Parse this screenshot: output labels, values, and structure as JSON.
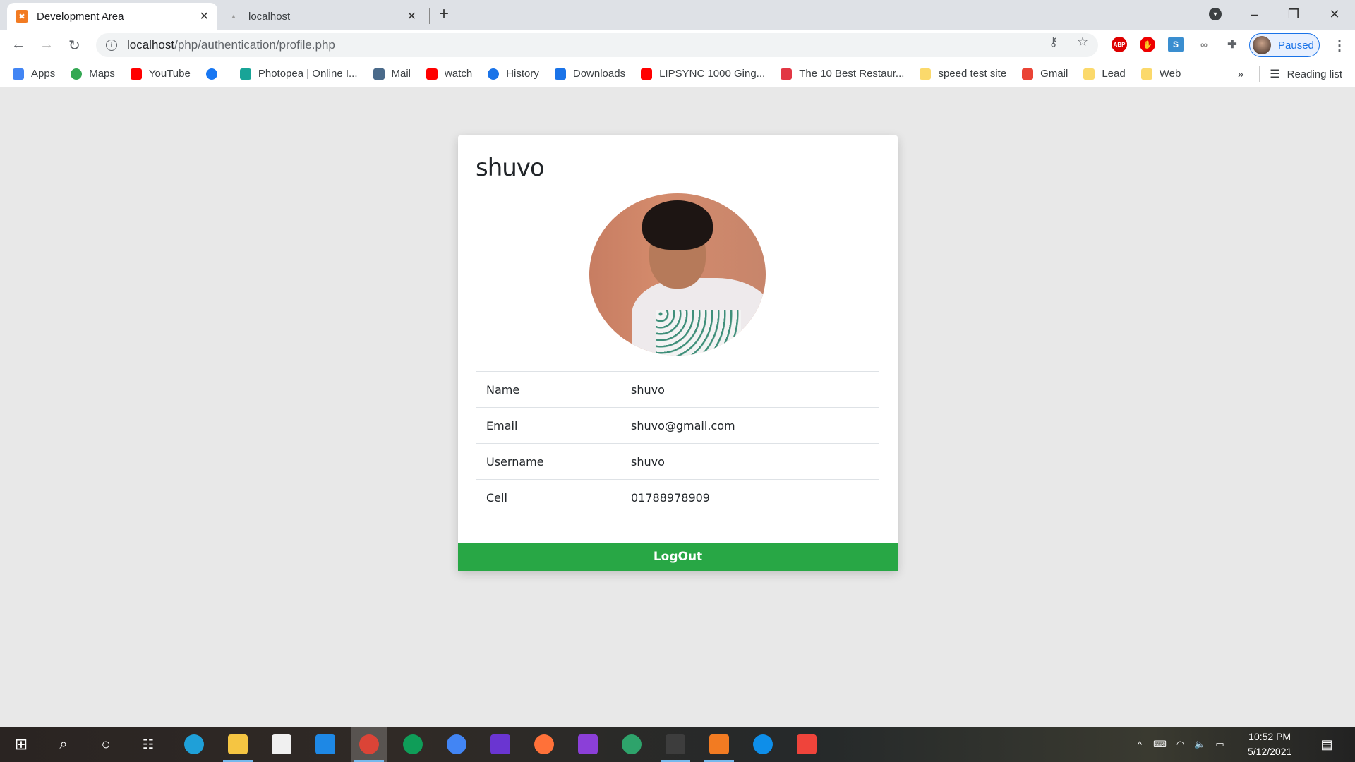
{
  "browser": {
    "tabs": [
      {
        "title": "Development Area",
        "active": true,
        "icon": "xampp-icon"
      },
      {
        "title": "localhost",
        "active": false,
        "icon": "phpmyadmin-icon"
      }
    ],
    "url_host": "localhost",
    "url_path": "/php/authentication/profile.php",
    "profile_status": "Paused",
    "bookmarks": [
      {
        "label": "Apps",
        "icon": "apps-grid-icon",
        "color": "#4285f4"
      },
      {
        "label": "Maps",
        "icon": "maps-pin-icon",
        "color": "#34a853"
      },
      {
        "label": "YouTube",
        "icon": "youtube-icon",
        "color": "#ff0000"
      },
      {
        "label": "",
        "icon": "facebook-icon",
        "color": "#1877f2"
      },
      {
        "label": "Photopea | Online I...",
        "icon": "photopea-icon",
        "color": "#18a497"
      },
      {
        "label": "Mail",
        "icon": "mail-icon",
        "color": "#4a6a8a"
      },
      {
        "label": "watch",
        "icon": "youtube-icon",
        "color": "#ff0000"
      },
      {
        "label": "History",
        "icon": "history-icon",
        "color": "#1a73e8"
      },
      {
        "label": "Downloads",
        "icon": "download-icon",
        "color": "#1a73e8"
      },
      {
        "label": "LIPSYNC 1000 Ging...",
        "icon": "youtube-icon",
        "color": "#ff0000"
      },
      {
        "label": "The 10 Best Restaur...",
        "icon": "zomato-icon",
        "color": "#e23744"
      },
      {
        "label": "speed test site",
        "icon": "folder-icon",
        "color": "#fbd96b"
      },
      {
        "label": "Gmail",
        "icon": "gmail-icon",
        "color": "#ea4335"
      },
      {
        "label": "Lead",
        "icon": "folder-icon",
        "color": "#fbd96b"
      },
      {
        "label": "Web",
        "icon": "folder-icon",
        "color": "#fbd96b"
      }
    ],
    "overflow": "»",
    "reading_list": "Reading list"
  },
  "profile": {
    "heading": "shuvo",
    "rows": [
      {
        "label": "Name",
        "value": "shuvo"
      },
      {
        "label": "Email",
        "value": "shuvo@gmail.com"
      },
      {
        "label": "Username",
        "value": "shuvo"
      },
      {
        "label": "Cell",
        "value": "01788978909"
      }
    ],
    "logout_label": "LogOut",
    "accent": "#28a745"
  },
  "taskbar": {
    "apps": [
      {
        "name": "edge",
        "color": "#1fa0d8"
      },
      {
        "name": "file-explorer",
        "color": "#f5c542"
      },
      {
        "name": "store",
        "color": "#f0f0f0"
      },
      {
        "name": "mail",
        "color": "#1e88e5"
      },
      {
        "name": "chrome",
        "color": "#db4437"
      },
      {
        "name": "chrome-profile-2",
        "color": "#0f9d58"
      },
      {
        "name": "chrome-profile-3",
        "color": "#4285f4"
      },
      {
        "name": "visual-studio",
        "color": "#6a35d1"
      },
      {
        "name": "firefox",
        "color": "#ff7139"
      },
      {
        "name": "phpstorm",
        "color": "#8b3fd8"
      },
      {
        "name": "app-green",
        "color": "#2ea36b"
      },
      {
        "name": "sublime-text",
        "color": "#3d3d3d"
      },
      {
        "name": "xampp",
        "color": "#f27b22"
      },
      {
        "name": "teamviewer",
        "color": "#0e8ee9"
      },
      {
        "name": "anydesk",
        "color": "#ef443b"
      }
    ],
    "time": "10:52 PM",
    "date": "5/12/2021"
  }
}
